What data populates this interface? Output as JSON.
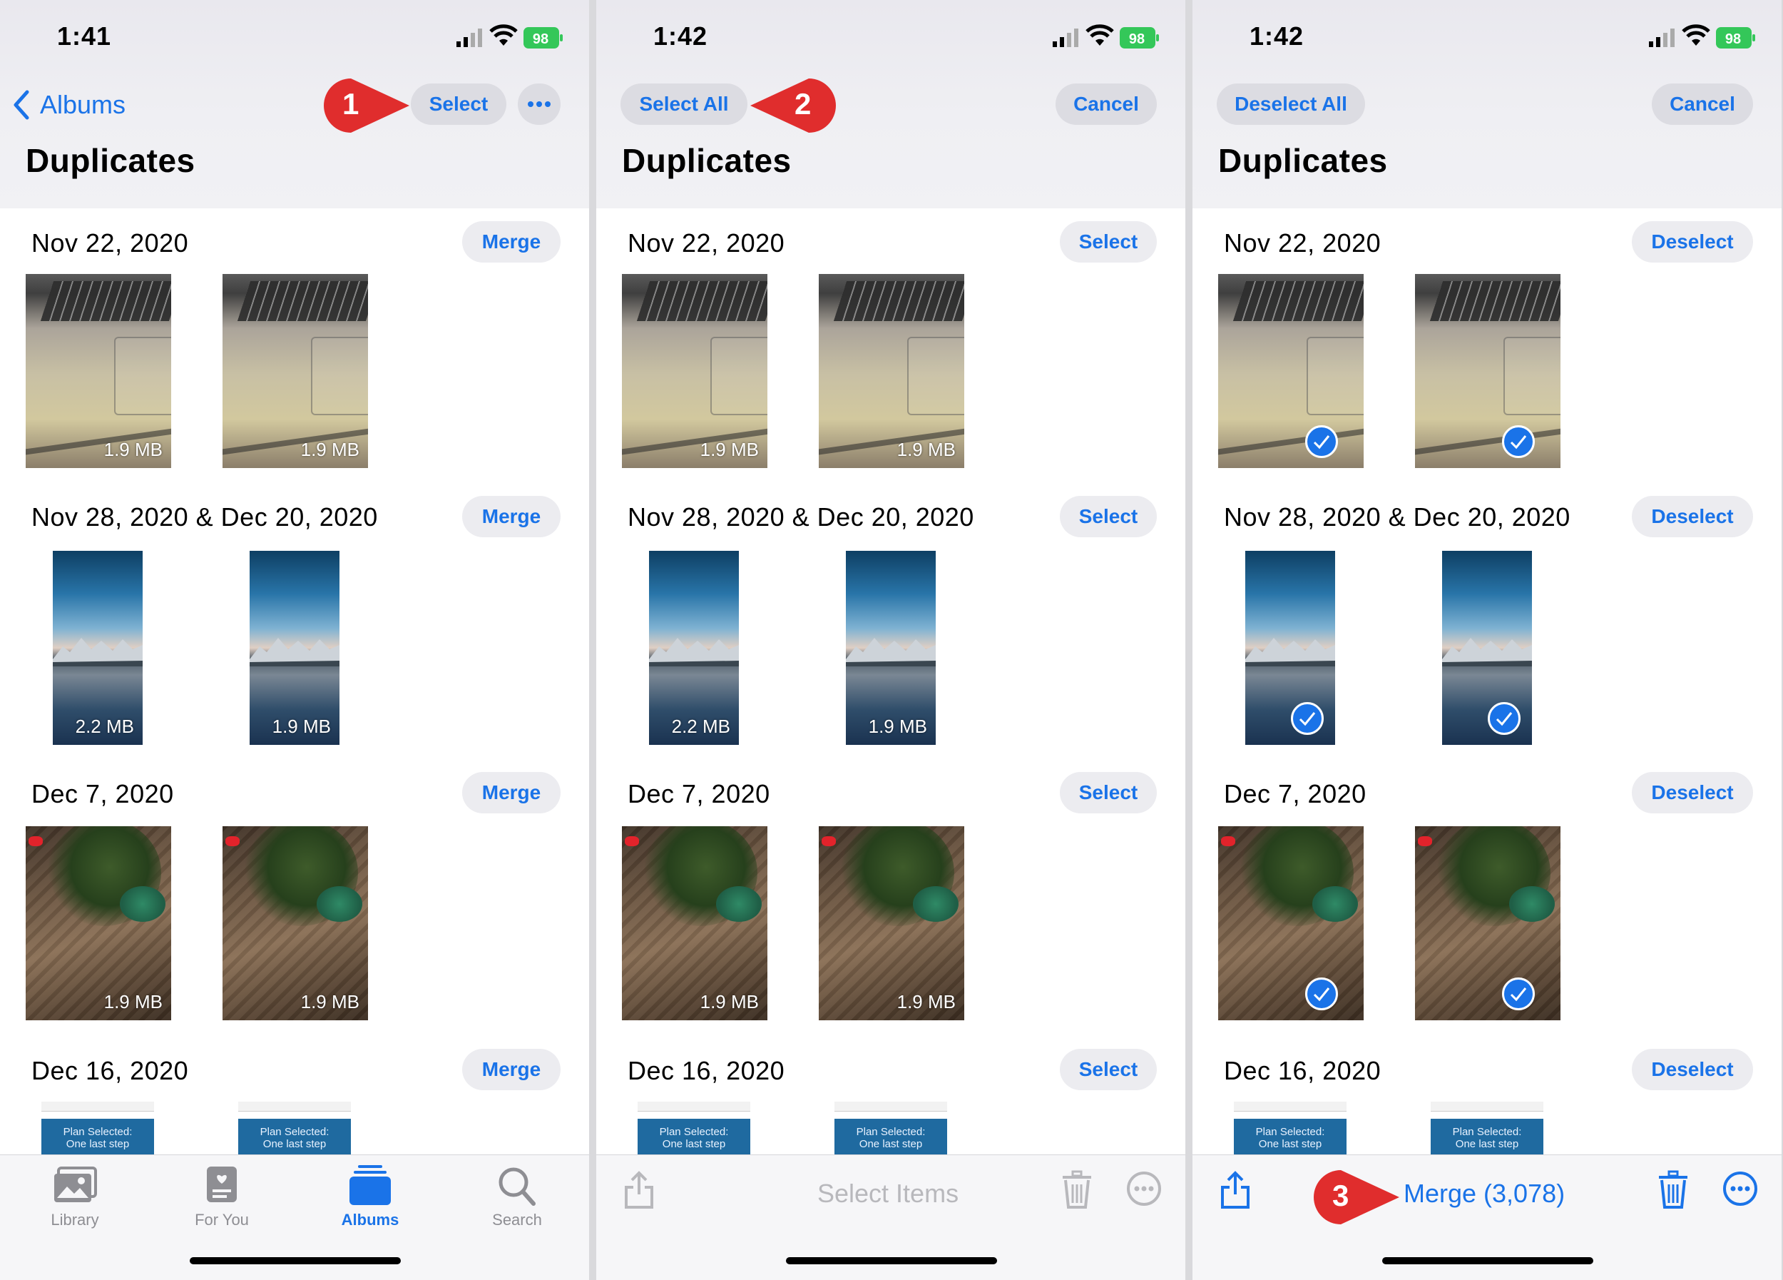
{
  "colors": {
    "accent": "#1a73e8",
    "battery": "#34c759",
    "step_badge": "#e02d2d"
  },
  "panels": [
    {
      "status": {
        "time": "1:41",
        "battery": "98"
      },
      "nav": {
        "back_label": "Albums",
        "select_label": "Select",
        "more_icon": "ellipsis-icon"
      },
      "title": "Duplicates",
      "groups": [
        {
          "date": "Nov 22, 2020",
          "button": "Merge",
          "sizes": [
            "1.9 MB",
            "1.9 MB"
          ]
        },
        {
          "date": "Nov 28, 2020 & Dec 20, 2020",
          "button": "Merge",
          "sizes": [
            "2.2 MB",
            "1.9 MB"
          ]
        },
        {
          "date": "Dec 7, 2020",
          "button": "Merge",
          "sizes": [
            "1.9 MB",
            "1.9 MB"
          ]
        },
        {
          "date": "Dec 16, 2020",
          "button": "Merge",
          "sizes": [
            "",
            ""
          ]
        }
      ],
      "tabs": [
        {
          "label": "Library",
          "icon": "photo-library-icon"
        },
        {
          "label": "For You",
          "icon": "for-you-icon"
        },
        {
          "label": "Albums",
          "icon": "albums-icon"
        },
        {
          "label": "Search",
          "icon": "search-icon"
        }
      ],
      "step": "1"
    },
    {
      "status": {
        "time": "1:42",
        "battery": "98"
      },
      "nav": {
        "select_all_label": "Select All",
        "cancel_label": "Cancel"
      },
      "title": "Duplicates",
      "groups": [
        {
          "date": "Nov 22, 2020",
          "button": "Select",
          "sizes": [
            "1.9 MB",
            "1.9 MB"
          ]
        },
        {
          "date": "Nov 28, 2020 & Dec 20, 2020",
          "button": "Select",
          "sizes": [
            "2.2 MB",
            "1.9 MB"
          ]
        },
        {
          "date": "Dec 7, 2020",
          "button": "Select",
          "sizes": [
            "1.9 MB",
            "1.9 MB"
          ]
        },
        {
          "date": "Dec 16, 2020",
          "button": "Select",
          "sizes": [
            "",
            ""
          ]
        }
      ],
      "toolbar": {
        "label": "Select Items"
      },
      "step": "2"
    },
    {
      "status": {
        "time": "1:42",
        "battery": "98"
      },
      "nav": {
        "deselect_all_label": "Deselect All",
        "cancel_label": "Cancel"
      },
      "title": "Duplicates",
      "groups": [
        {
          "date": "Nov 22, 2020",
          "button": "Deselect"
        },
        {
          "date": "Nov 28, 2020 & Dec 20, 2020",
          "button": "Deselect"
        },
        {
          "date": "Dec 7, 2020",
          "button": "Deselect"
        },
        {
          "date": "Dec 16, 2020",
          "button": "Deselect"
        }
      ],
      "toolbar": {
        "merge_label": "Merge (3,078)"
      },
      "step": "3"
    }
  ],
  "screenshot_thumb": {
    "line1": "Plan Selected:",
    "line2": "One last step"
  }
}
